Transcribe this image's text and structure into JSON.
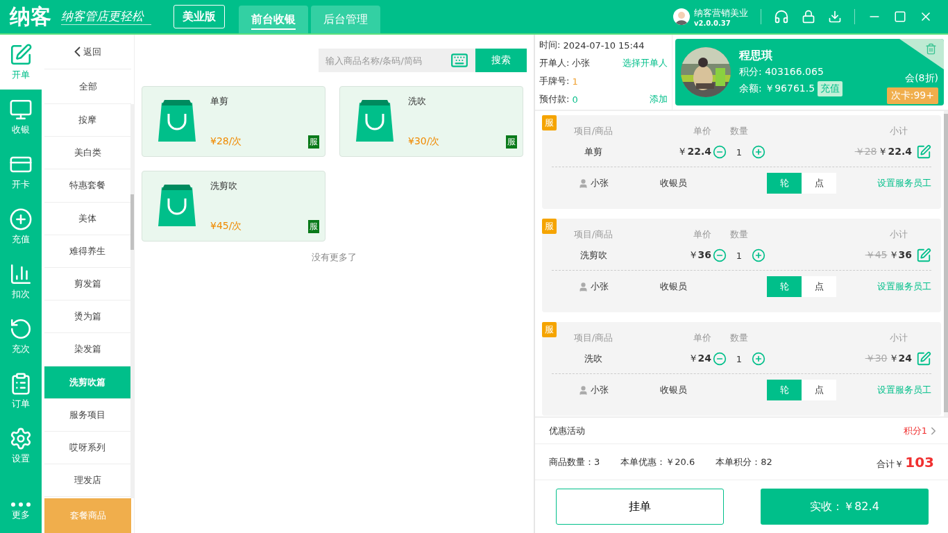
{
  "app": {
    "logo": "纳客",
    "slogan": "纳客管店更轻松",
    "edition": "美业版"
  },
  "top_tabs": [
    {
      "label": "前台收银",
      "selected": true
    },
    {
      "label": "后台管理",
      "selected": false
    }
  ],
  "account": {
    "name": "纳客营销美业",
    "version": "v2.0.0.37"
  },
  "nav": [
    {
      "label": "开单",
      "selected": true
    },
    {
      "label": "收银",
      "selected": false
    },
    {
      "label": "开卡",
      "selected": false
    },
    {
      "label": "充值",
      "selected": false
    },
    {
      "label": "扣次",
      "selected": false
    },
    {
      "label": "充次",
      "selected": false
    },
    {
      "label": "订单",
      "selected": false
    },
    {
      "label": "设置",
      "selected": false
    }
  ],
  "nav_more": "更多",
  "categories": {
    "back": "返回",
    "pinned": "全部",
    "items": [
      {
        "label": "按摩",
        "selected": false
      },
      {
        "label": "美白类",
        "selected": false
      },
      {
        "label": "特惠套餐",
        "selected": false
      },
      {
        "label": "美体",
        "selected": false
      },
      {
        "label": "难得养生",
        "selected": false
      },
      {
        "label": "剪发篇",
        "selected": false
      },
      {
        "label": "烫为篇",
        "selected": false
      },
      {
        "label": "染发篇",
        "selected": false
      },
      {
        "label": "洗剪吹篇",
        "selected": true
      },
      {
        "label": "服务项目",
        "selected": false
      },
      {
        "label": "哎呀系列",
        "selected": false
      },
      {
        "label": "理发店",
        "selected": false
      }
    ],
    "package": "套餐商品"
  },
  "search": {
    "placeholder": "输入商品名称/条码/简码",
    "button": "搜索"
  },
  "products": [
    {
      "name": "单剪",
      "price": "¥28/次",
      "tag": "服"
    },
    {
      "name": "洗吹",
      "price": "¥30/次",
      "tag": "服"
    },
    {
      "name": "洗剪吹",
      "price": "¥45/次",
      "tag": "服"
    }
  ],
  "end_note": "没有更多了",
  "order_info": [
    {
      "label": "时间:",
      "value": "2024-07-10 15:44"
    },
    {
      "label": "开单人:",
      "value": "小张",
      "action": "选择开单人"
    },
    {
      "label": "手牌号:",
      "value": "1",
      "color": "#f0a030"
    },
    {
      "label": "预付款:",
      "value": "0",
      "color": "#0abf8b",
      "action": "添加"
    }
  ],
  "member": {
    "name": "程思琪",
    "points": "积分: 403166.065",
    "balance": "余额: ￥96761.5",
    "recharge": "充值",
    "level": "会(8折)",
    "card_count": "次卡:99+"
  },
  "lines": [
    {
      "tag": "服",
      "columns": [
        "项目/商品",
        "单价",
        "数量",
        "小计"
      ],
      "name": "单剪",
      "unit_price": "￥**22.4**",
      "qty": "1",
      "original": "￥28",
      "subtotal": "￥**22.4**",
      "staff": "小张",
      "role": "收银员",
      "modes": [
        {
          "label": "轮",
          "selected": true
        },
        {
          "label": "点",
          "selected": false
        }
      ],
      "assign": "设置服务员工"
    },
    {
      "tag": "服",
      "columns": [
        "项目/商品",
        "单价",
        "数量",
        "小计"
      ],
      "name": "洗剪吹",
      "unit_price": "￥**36**",
      "qty": "1",
      "original": "￥45",
      "subtotal": "￥**36**",
      "staff": "小张",
      "role": "收银员",
      "modes": [
        {
          "label": "轮",
          "selected": true
        },
        {
          "label": "点",
          "selected": false
        }
      ],
      "assign": "设置服务员工"
    },
    {
      "tag": "服",
      "columns": [
        "项目/商品",
        "单价",
        "数量",
        "小计"
      ],
      "name": "洗吹",
      "unit_price": "￥**24**",
      "qty": "1",
      "original": "￥30",
      "subtotal": "￥**24**",
      "staff": "小张",
      "role": "收银员",
      "modes": [
        {
          "label": "轮",
          "selected": true
        },
        {
          "label": "点",
          "selected": false
        }
      ],
      "assign": "设置服务员工"
    }
  ],
  "promotion": {
    "label": "优惠活动",
    "value": "积分1"
  },
  "summary": {
    "count": "商品数量：3",
    "discount": "本单优惠：￥20.6",
    "points": "本单积分：82",
    "total_label": "合计￥",
    "total": "103"
  },
  "actions": {
    "hold": "挂单",
    "pay": "实收：￥82.4"
  }
}
